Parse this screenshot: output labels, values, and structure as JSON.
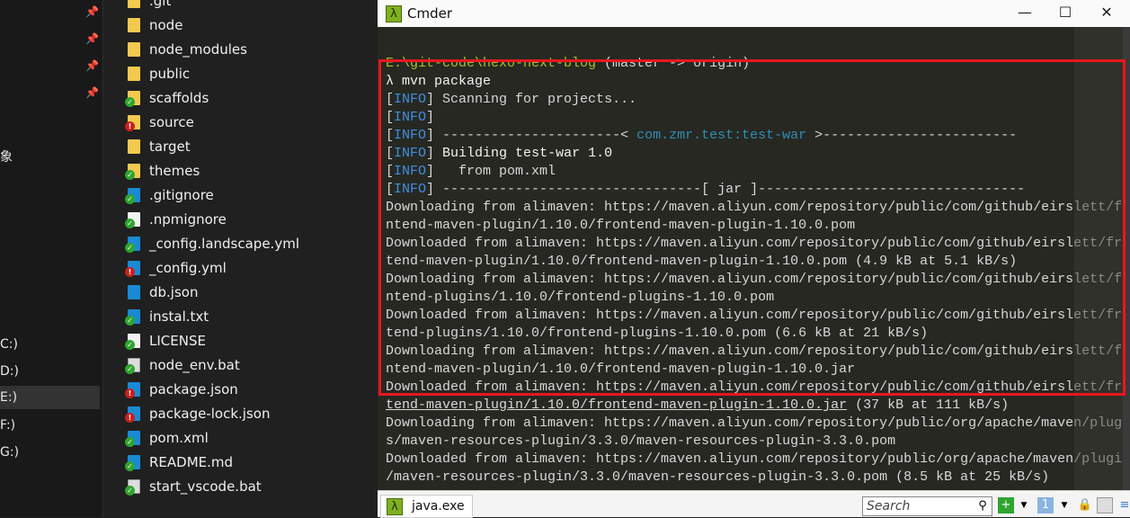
{
  "nav": {
    "partial_label": "象",
    "drives": [
      "C:)",
      "D:)",
      "E:)",
      "F:)",
      "G:)"
    ],
    "selected_drive": "E:)"
  },
  "files": [
    {
      "name": ".git",
      "type": "folder",
      "status": "none"
    },
    {
      "name": "node",
      "type": "folder",
      "status": "none"
    },
    {
      "name": "node_modules",
      "type": "folder",
      "status": "none"
    },
    {
      "name": "public",
      "type": "folder",
      "status": "none"
    },
    {
      "name": "scaffolds",
      "type": "folder",
      "status": "ok"
    },
    {
      "name": "source",
      "type": "folder",
      "status": "modified"
    },
    {
      "name": "target",
      "type": "folder",
      "status": "none"
    },
    {
      "name": "themes",
      "type": "folder",
      "status": "ok"
    },
    {
      "name": ".gitignore",
      "type": "doc",
      "status": "ok"
    },
    {
      "name": ".npmignore",
      "type": "txt",
      "status": "ok"
    },
    {
      "name": "_config.landscape.yml",
      "type": "doc",
      "status": "ok"
    },
    {
      "name": "_config.yml",
      "type": "doc",
      "status": "modified"
    },
    {
      "name": "db.json",
      "type": "doc",
      "status": "none"
    },
    {
      "name": "instal.txt",
      "type": "doc",
      "status": "ok"
    },
    {
      "name": "LICENSE",
      "type": "txt",
      "status": "ok"
    },
    {
      "name": "node_env.bat",
      "type": "bat",
      "status": "ok"
    },
    {
      "name": "package.json",
      "type": "doc",
      "status": "modified"
    },
    {
      "name": "package-lock.json",
      "type": "doc",
      "status": "modified"
    },
    {
      "name": "pom.xml",
      "type": "doc",
      "status": "ok"
    },
    {
      "name": "README.md",
      "type": "doc",
      "status": "ok"
    },
    {
      "name": "start_vscode.bat",
      "type": "bat",
      "status": "ok"
    }
  ],
  "window": {
    "title": "Cmder",
    "minimize": "—",
    "maximize": "☐",
    "close": "✕"
  },
  "terminal": {
    "lines": [
      [
        {
          "t": "E:\\git-code\\hexo-next-blog",
          "c": "g"
        },
        {
          "t": " (master -> origin)",
          "c": "y"
        }
      ],
      [
        {
          "t": "λ mvn package",
          "c": "w"
        }
      ],
      [
        {
          "t": "[",
          "c": ""
        },
        {
          "t": "INFO",
          "c": "b"
        },
        {
          "t": "] Scanning for projects...",
          "c": ""
        }
      ],
      [
        {
          "t": "[",
          "c": ""
        },
        {
          "t": "INFO",
          "c": "b"
        },
        {
          "t": "]",
          "c": ""
        }
      ],
      [
        {
          "t": "[",
          "c": ""
        },
        {
          "t": "INFO",
          "c": "b"
        },
        {
          "t": "] ----------------------< ",
          "c": ""
        },
        {
          "t": "com.zmr.test:test-war",
          "c": "c"
        },
        {
          "t": " >------------------------",
          "c": ""
        }
      ],
      [
        {
          "t": "[",
          "c": ""
        },
        {
          "t": "INFO",
          "c": "b"
        },
        {
          "t": "] ",
          "c": ""
        },
        {
          "t": "Building test-war 1.0",
          "c": "w"
        }
      ],
      [
        {
          "t": "[",
          "c": ""
        },
        {
          "t": "INFO",
          "c": "b"
        },
        {
          "t": "]   from pom.xml",
          "c": ""
        }
      ],
      [
        {
          "t": "[",
          "c": ""
        },
        {
          "t": "INFO",
          "c": "b"
        },
        {
          "t": "] --------------------------------[ jar ]---------------------------------",
          "c": ""
        }
      ],
      [
        {
          "t": "Downloading from alimaven: https://maven.aliyun.com/repository/public/com/github/eirslett/fr",
          "c": ""
        }
      ],
      [
        {
          "t": "ntend-maven-plugin/1.10.0/frontend-maven-plugin-1.10.0.pom",
          "c": ""
        }
      ],
      [
        {
          "t": "Downloaded from alimaven: https://maven.aliyun.com/repository/public/com/github/eirslett/fron",
          "c": ""
        }
      ],
      [
        {
          "t": "tend-maven-plugin/1.10.0/frontend-maven-plugin-1.10.0.pom (4.9 kB at 5.1 kB/s)",
          "c": ""
        }
      ],
      [
        {
          "t": "Downloading from alimaven: https://maven.aliyun.com/repository/public/com/github/eirslett/fr",
          "c": ""
        }
      ],
      [
        {
          "t": "ntend-plugins/1.10.0/frontend-plugins-1.10.0.pom",
          "c": ""
        }
      ],
      [
        {
          "t": "Downloaded from alimaven: https://maven.aliyun.com/repository/public/com/github/eirslett/fro",
          "c": ""
        }
      ],
      [
        {
          "t": "tend-plugins/1.10.0/frontend-plugins-1.10.0.pom (6.6 kB at 21 kB/s)",
          "c": ""
        }
      ],
      [
        {
          "t": "Downloading from alimaven: https://maven.aliyun.com/repository/public/com/github/eirslett/fr",
          "c": ""
        }
      ],
      [
        {
          "t": "ntend-maven-plugin/1.10.0/frontend-maven-plugin-1.10.0.jar",
          "c": ""
        }
      ],
      [
        {
          "t": "Downloaded from alimaven: https://maven.aliyun.com/repository/public/com/github/eirslett/fro",
          "c": ""
        }
      ],
      [
        {
          "t": "tend-maven-plugin/1.10.0/frontend-maven-plugin-1.10.0.jar",
          "c": "u"
        },
        {
          "t": " (37 kB at 111 kB/s)",
          "c": ""
        }
      ],
      [
        {
          "t": "Downloading from alimaven: https://maven.aliyun.com/repository/public/org/apache/maven/plugi",
          "c": ""
        }
      ],
      [
        {
          "t": "s/maven-resources-plugin/3.3.0/maven-resources-plugin-3.3.0.pom",
          "c": ""
        }
      ],
      [
        {
          "t": "Downloaded from alimaven: https://maven.aliyun.com/repository/public/org/apache/maven/plugin",
          "c": ""
        }
      ],
      [
        {
          "t": "/maven-resources-plugin/3.3.0/maven-resources-plugin-3.3.0.pom (8.5 kB at 25 kB/s)",
          "c": ""
        }
      ]
    ]
  },
  "statusbar": {
    "tab_label": "java.exe",
    "search_placeholder": "Search"
  },
  "colors": {
    "highlight_box": "#e8161e",
    "info": "#3f8fdf",
    "prompt_path": "#a6c02a",
    "terminal_bg": "#272822"
  }
}
